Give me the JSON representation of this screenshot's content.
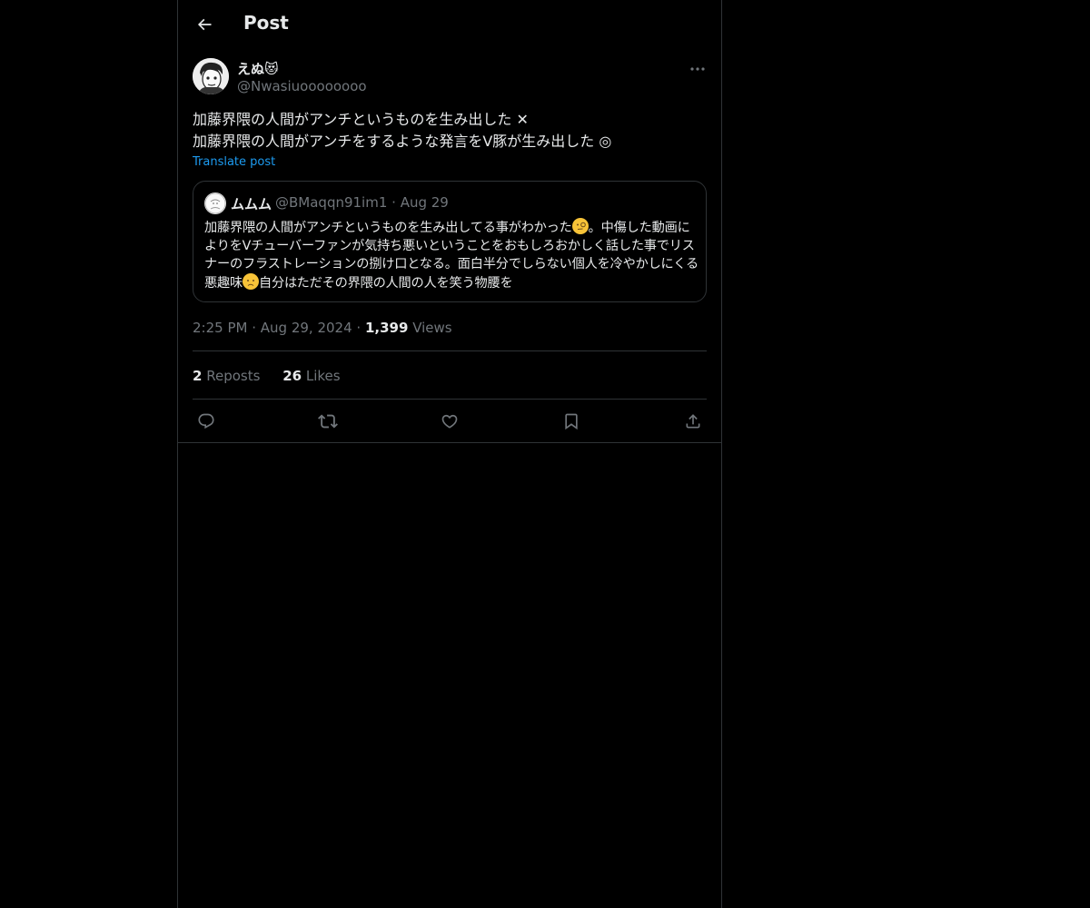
{
  "header": {
    "title": "Post",
    "back_icon": "arrow-left-icon"
  },
  "post": {
    "author": {
      "name": "えぬ😻",
      "handle": "@Nwasiuoooooooo",
      "avatar_icon": "avatar-manga-face"
    },
    "more_icon": "more-dots-icon",
    "lines": [
      "加藤界隈の人間がアンチというものを生み出した ✕",
      "加藤界隈の人間がアンチをするような発言をV豚が生み出した ◎"
    ],
    "translate_label": "Translate post",
    "quote": {
      "name": "ムムム",
      "handle": "@BMaqqn91im1",
      "date": "Aug 29",
      "text_part1": "加藤界隈の人間がアンチというものを生み出してる事がわかった",
      "text_part2": "。中傷した動画によりをVチューバーファンが気持ち悪いということをおもしろおかしく話した事でリスナーのフラストレーションの捌け口となる。面白半分でしらない個人を冷やかしにくる悪趣味",
      "text_part3": "自分はただその界隈の人間の人を笑う物腰を"
    },
    "time": "2:25 PM",
    "date": "Aug 29, 2024",
    "views_count": "1,399",
    "views_label": "Views",
    "reposts_count": "2",
    "reposts_label": "Reposts",
    "likes_count": "26",
    "likes_label": "Likes"
  },
  "colors": {
    "background": "#000000",
    "text": "#e7e9ea",
    "muted": "#71767b",
    "link": "#1d9bf0",
    "border": "#2f3336"
  }
}
